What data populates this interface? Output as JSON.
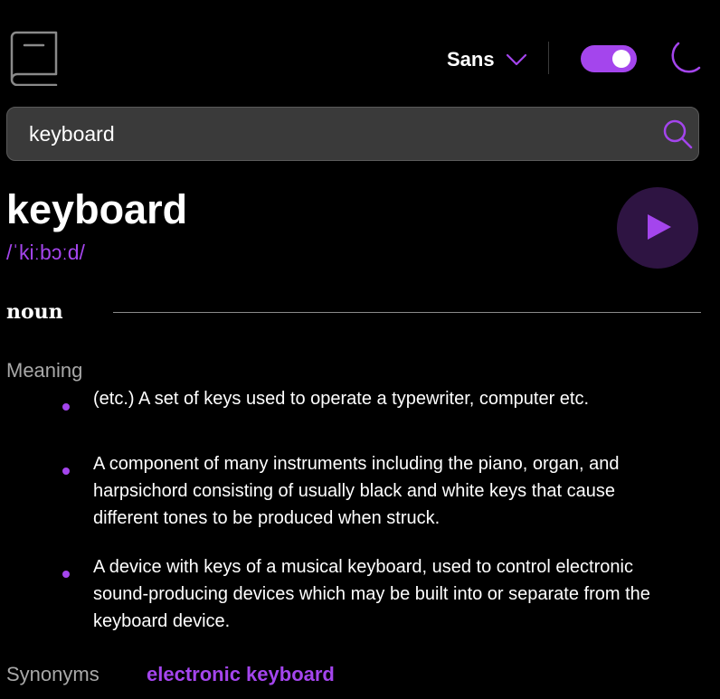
{
  "header": {
    "logo_icon": "book-icon",
    "font_selector": {
      "label": "Sans",
      "icon": "chevron-down-icon"
    },
    "theme_toggle": {
      "state": "on"
    },
    "theme_icon": "moon-icon"
  },
  "search": {
    "value": "keyboard",
    "icon": "search-icon"
  },
  "entry": {
    "word": "keyboard",
    "phonetic": "/ˈkiːbɔːd/",
    "play_icon": "play-icon",
    "part_of_speech": "noun",
    "meaning_heading": "Meaning",
    "definitions": [
      "(etc.) A set of keys used to operate a typewriter, computer etc.",
      "A component of many instruments including the piano, organ, and harpsichord consisting of usually black and white keys that cause different tones to be produced when struck.",
      "A device with keys of a musical keyboard, used to control electronic sound-producing devices which may be built into or separate from the keyboard device."
    ],
    "synonyms_heading": "Synonyms",
    "synonyms": [
      "electronic keyboard"
    ]
  },
  "colors": {
    "accent": "#a445ed",
    "background": "#000000",
    "search_bg": "#3a3a3a",
    "play_bg": "#2e1442",
    "muted_text": "#a8a8a8"
  }
}
